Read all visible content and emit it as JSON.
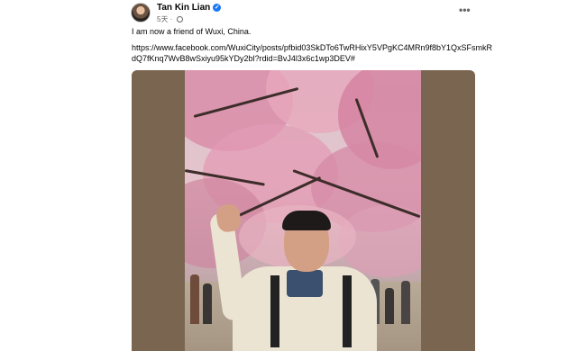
{
  "post": {
    "author": "Tan Kin Lian",
    "time": "5天",
    "caption": "I am now a friend of Wuxi, China.",
    "link": "https://www.facebook.com/WuxiCity/posts/pfbid03SkDTo6TwRHixY5VPgKC4MRn9f8bY1QxSFsmkRdQ7fKnq7WvB8wSxiyu95kYDy2bl?rdid=BvJ4l3x6c1wp3DEV#",
    "verified_icon": "verified-badge-icon",
    "privacy_icon": "globe-icon",
    "more_icon": "more-options-icon"
  },
  "colors": {
    "brand_blue": "#1877f2",
    "media_background": "#7a6650",
    "meta_text": "#65676b"
  }
}
